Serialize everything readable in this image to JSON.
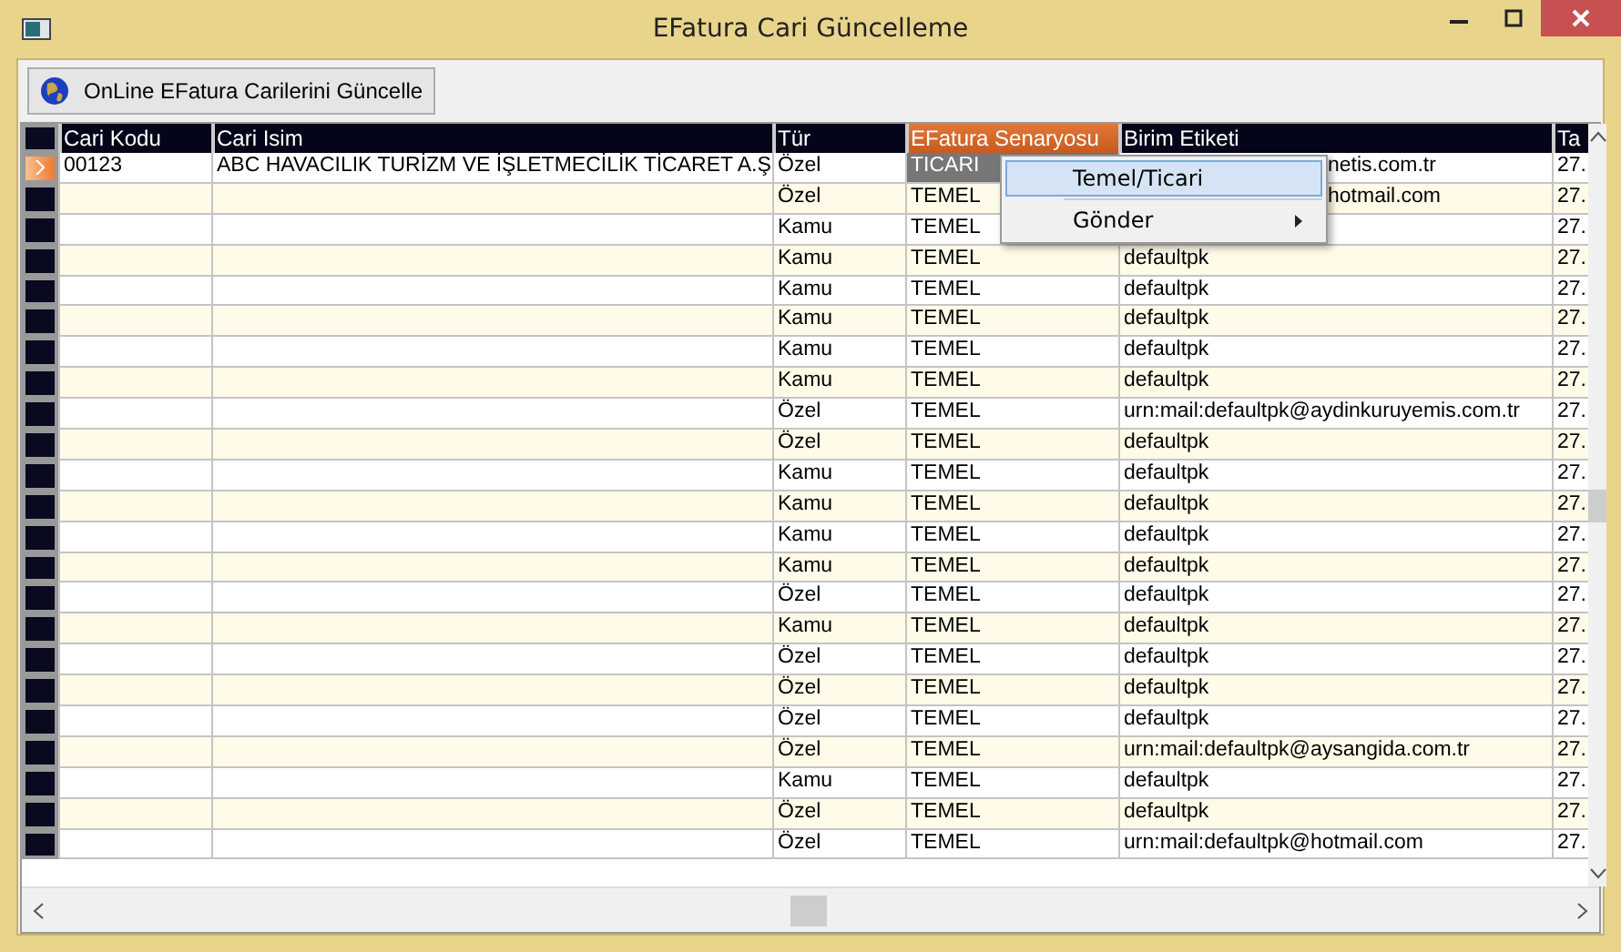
{
  "window": {
    "title": "EFatura Cari Güncelleme"
  },
  "toolbar": {
    "button": "OnLine EFatura Carilerini Güncelle"
  },
  "table": {
    "columns": [
      {
        "label": "Cari Kodu",
        "selected": false
      },
      {
        "label": "Cari Isim",
        "selected": false
      },
      {
        "label": "Tür",
        "selected": false
      },
      {
        "label": "EFatura Senaryosu",
        "selected": true
      },
      {
        "label": "Birim Etiketi",
        "selected": false
      },
      {
        "label": "Ta",
        "selected": false
      }
    ],
    "rows": [
      {
        "selected": true,
        "cells": [
          "00123",
          "ABC HAVACILIK TURİZM VE İŞLETMECİLİK TİCARET A.Ş",
          "Özel",
          "TICARI",
          "netis.com.tr",
          "27."
        ],
        "covered": true
      },
      {
        "selected": false,
        "cells": [
          "",
          "",
          "Özel",
          "TEMEL",
          "hotmail.com",
          "27."
        ],
        "covered": true
      },
      {
        "selected": false,
        "cells": [
          "",
          "",
          "Kamu",
          "TEMEL",
          "",
          "27."
        ]
      },
      {
        "selected": false,
        "cells": [
          "",
          "",
          "Kamu",
          "TEMEL",
          "defaultpk",
          "27."
        ],
        "covered": false
      },
      {
        "selected": false,
        "cells": [
          "",
          "",
          "Kamu",
          "TEMEL",
          "defaultpk",
          "27."
        ],
        "covered": false
      },
      {
        "selected": false,
        "cells": [
          "",
          "",
          "Kamu",
          "TEMEL",
          "defaultpk",
          "27."
        ],
        "covered": false
      },
      {
        "selected": false,
        "cells": [
          "",
          "",
          "Kamu",
          "TEMEL",
          "defaultpk",
          "27."
        ],
        "covered": false
      },
      {
        "selected": false,
        "cells": [
          "",
          "",
          "Kamu",
          "TEMEL",
          "defaultpk",
          "27."
        ],
        "covered": false
      },
      {
        "selected": false,
        "cells": [
          "",
          "",
          "Özel",
          "TEMEL",
          "urn:mail:defaultpk@aydinkuruyemis.com.tr",
          "27."
        ],
        "covered": false
      },
      {
        "selected": false,
        "cells": [
          "",
          "",
          "Özel",
          "TEMEL",
          "defaultpk",
          "27."
        ],
        "covered": false
      },
      {
        "selected": false,
        "cells": [
          "",
          "",
          "Kamu",
          "TEMEL",
          "defaultpk",
          "27."
        ],
        "covered": false
      },
      {
        "selected": false,
        "cells": [
          "",
          "",
          "Kamu",
          "TEMEL",
          "defaultpk",
          "27."
        ],
        "covered": false
      },
      {
        "selected": false,
        "cells": [
          "",
          "",
          "Kamu",
          "TEMEL",
          "defaultpk",
          "27."
        ],
        "covered": false
      },
      {
        "selected": false,
        "cells": [
          "",
          "",
          "Kamu",
          "TEMEL",
          "defaultpk",
          "27."
        ],
        "covered": false
      },
      {
        "selected": false,
        "cells": [
          "",
          "",
          "Özel",
          "TEMEL",
          "defaultpk",
          "27."
        ],
        "covered": false
      },
      {
        "selected": false,
        "cells": [
          "",
          "",
          "Kamu",
          "TEMEL",
          "defaultpk",
          "27."
        ],
        "covered": false
      },
      {
        "selected": false,
        "cells": [
          "",
          "",
          "Özel",
          "TEMEL",
          "defaultpk",
          "27."
        ],
        "covered": false
      },
      {
        "selected": false,
        "cells": [
          "",
          "",
          "Özel",
          "TEMEL",
          "defaultpk",
          "27."
        ],
        "covered": false
      },
      {
        "selected": false,
        "cells": [
          "",
          "",
          "Özel",
          "TEMEL",
          "defaultpk",
          "27."
        ],
        "covered": false
      },
      {
        "selected": false,
        "cells": [
          "",
          "",
          "Özel",
          "TEMEL",
          "urn:mail:defaultpk@aysangida.com.tr",
          "27."
        ],
        "covered": false
      },
      {
        "selected": false,
        "cells": [
          "",
          "",
          "Kamu",
          "TEMEL",
          "defaultpk",
          "27."
        ],
        "covered": false
      },
      {
        "selected": false,
        "cells": [
          "",
          "",
          "Özel",
          "TEMEL",
          "defaultpk",
          "27."
        ],
        "covered": false
      },
      {
        "selected": false,
        "cells": [
          "",
          "",
          "Özel",
          "TEMEL",
          "urn:mail:defaultpk@hotmail.com",
          "27."
        ],
        "covered": false
      }
    ]
  },
  "context_menu": {
    "items": [
      {
        "label": "Temel/Ticari",
        "selected": true,
        "submenu": false
      },
      {
        "label": "Gönder",
        "selected": false,
        "submenu": true
      }
    ]
  }
}
